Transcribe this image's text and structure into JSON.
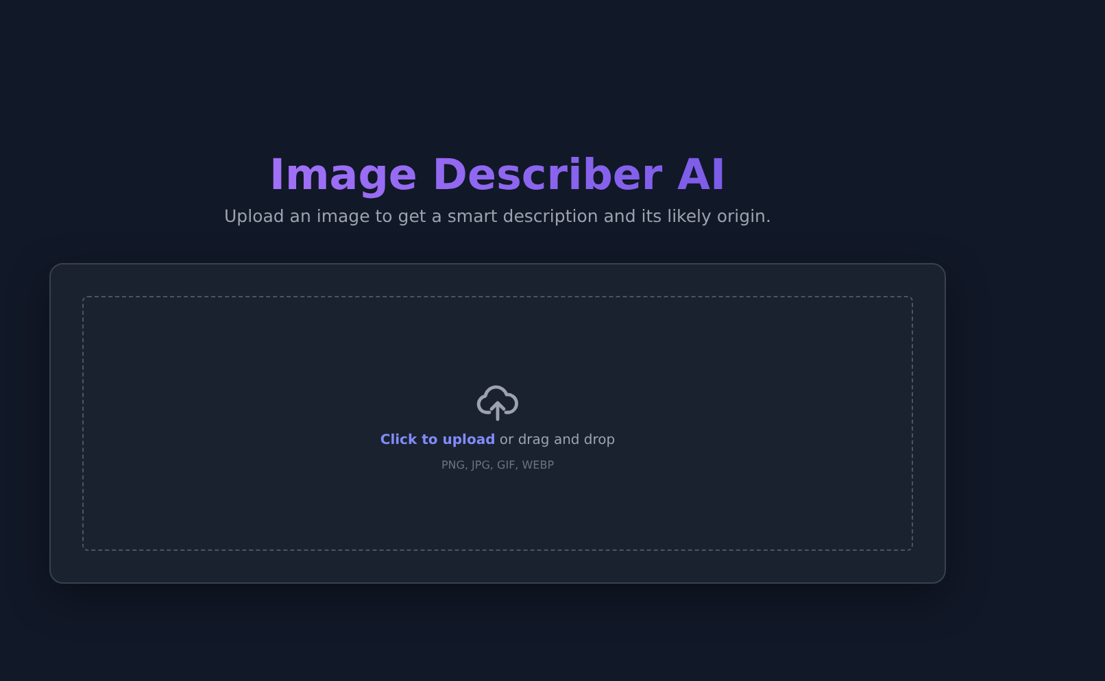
{
  "header": {
    "title": "Image Describer AI",
    "subtitle": "Upload an image to get a smart description and its likely origin."
  },
  "upload": {
    "link": "Click to upload",
    "text": "or drag and drop",
    "formats": "PNG, JPG, GIF, WEBP"
  }
}
